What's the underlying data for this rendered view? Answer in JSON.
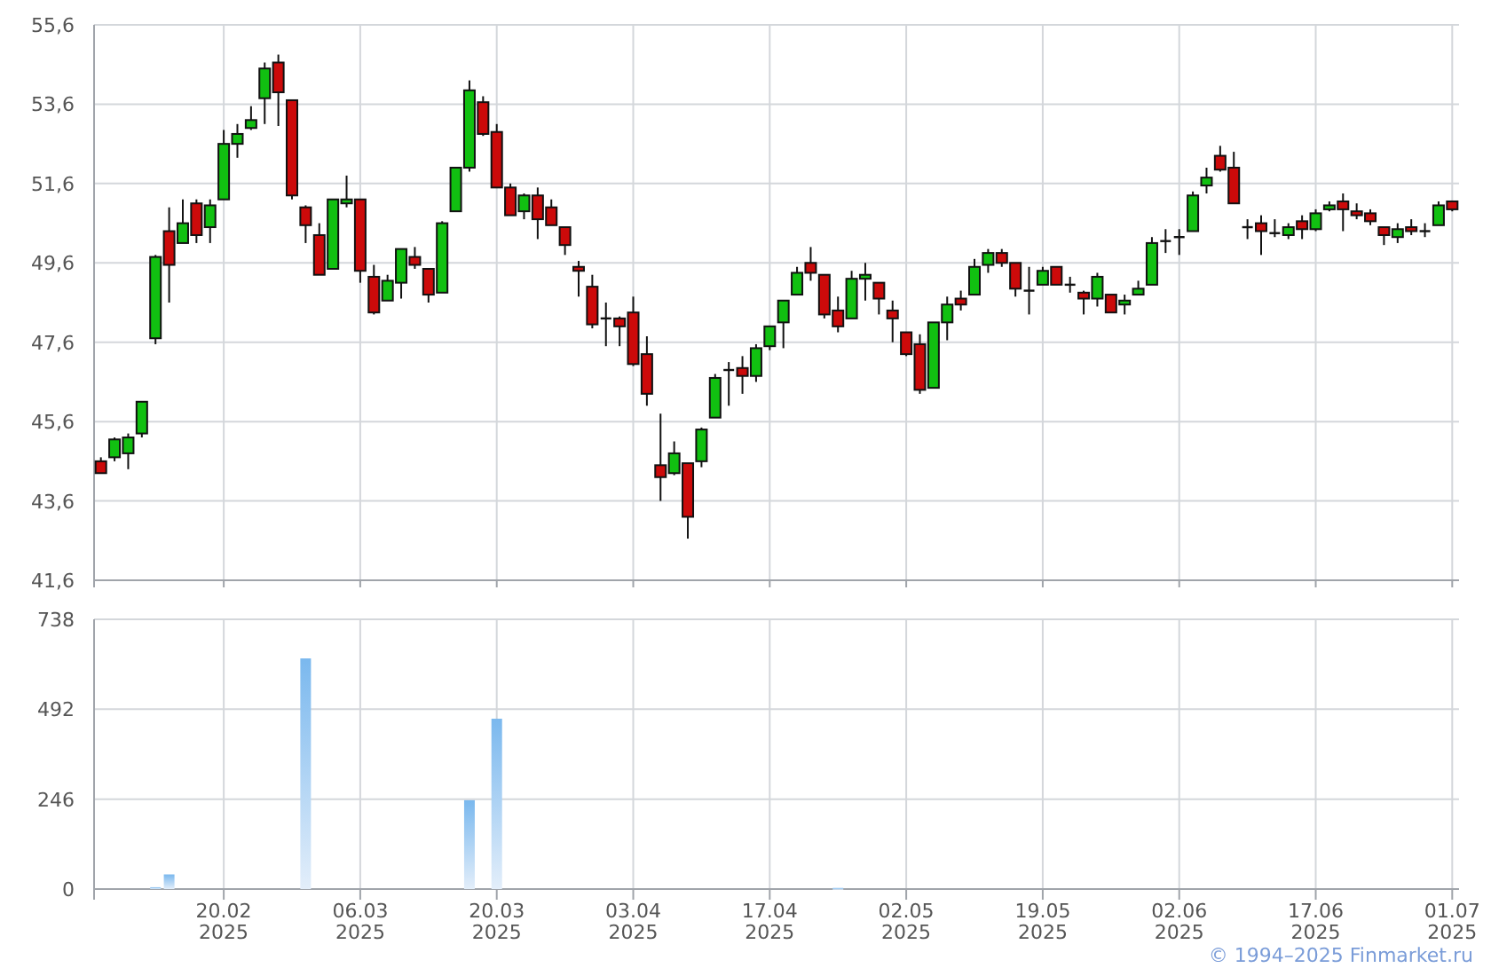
{
  "price_chart": {
    "chart_data": {
      "type": "candlestick",
      "grid": true,
      "categories": [
        null,
        null,
        null,
        null,
        null,
        null,
        null,
        null,
        null,
        null,
        null,
        null,
        null,
        null,
        null,
        null,
        null,
        null,
        null,
        null,
        null,
        null,
        null,
        null,
        null,
        null,
        null,
        null,
        null,
        null,
        null,
        null,
        null,
        null,
        null,
        null,
        null,
        null,
        null,
        null,
        null,
        null,
        null,
        null,
        null,
        null,
        null,
        null,
        null,
        null,
        null,
        null,
        null,
        null,
        null,
        null,
        null,
        null,
        null,
        null,
        null,
        null,
        null,
        null,
        null,
        null,
        null,
        null,
        null,
        null,
        null,
        null,
        null,
        null,
        null,
        null,
        null,
        null,
        null,
        null,
        null,
        null,
        null,
        null,
        null,
        null,
        null,
        null,
        null,
        null,
        null,
        null,
        null,
        null,
        null,
        null,
        null,
        null,
        null,
        null
      ],
      "ylim": [
        41.6,
        55.6
      ],
      "yticks": [
        {
          "value": 41.6,
          "label": "41,6"
        },
        {
          "value": 43.6,
          "label": "43,6"
        },
        {
          "value": 45.6,
          "label": "45,6"
        },
        {
          "value": 47.6,
          "label": "47,6"
        },
        {
          "value": 49.6,
          "label": "49,6"
        },
        {
          "value": 51.6,
          "label": "51,6"
        },
        {
          "value": 53.6,
          "label": "53,6"
        },
        {
          "value": 55.6,
          "label": "55,6"
        }
      ],
      "ohlc": [
        [
          44.6,
          44.7,
          44.3,
          44.3
        ],
        [
          44.7,
          45.2,
          44.6,
          45.15
        ],
        [
          44.8,
          45.3,
          44.4,
          45.2
        ],
        [
          45.3,
          46.1,
          45.2,
          46.1
        ],
        [
          47.7,
          49.8,
          47.55,
          49.75
        ],
        [
          50.4,
          51.0,
          48.6,
          49.55
        ],
        [
          50.1,
          51.2,
          50.1,
          50.6
        ],
        [
          51.1,
          51.2,
          50.1,
          50.3
        ],
        [
          50.5,
          51.2,
          50.1,
          51.05
        ],
        [
          51.2,
          52.95,
          51.2,
          52.6
        ],
        [
          52.6,
          53.1,
          52.25,
          52.85
        ],
        [
          53.0,
          53.55,
          52.95,
          53.2
        ],
        [
          53.75,
          54.65,
          53.1,
          54.5
        ],
        [
          54.65,
          54.85,
          53.05,
          53.9
        ],
        [
          53.7,
          53.7,
          51.2,
          51.3
        ],
        [
          51.0,
          51.05,
          50.1,
          50.55
        ],
        [
          50.3,
          50.6,
          49.3,
          49.3
        ],
        [
          49.45,
          51.2,
          49.45,
          51.2
        ],
        [
          51.1,
          51.8,
          51.0,
          51.2
        ],
        [
          51.2,
          51.2,
          49.1,
          49.4
        ],
        [
          49.25,
          49.55,
          48.3,
          48.35
        ],
        [
          48.65,
          49.3,
          48.65,
          49.15
        ],
        [
          49.1,
          49.95,
          48.7,
          49.95
        ],
        [
          49.75,
          50.0,
          49.45,
          49.55
        ],
        [
          49.45,
          49.45,
          48.6,
          48.8
        ],
        [
          48.85,
          50.65,
          48.85,
          50.6
        ],
        [
          50.9,
          52.0,
          50.9,
          52.0
        ],
        [
          52.0,
          54.2,
          51.9,
          53.95
        ],
        [
          53.65,
          53.8,
          52.8,
          52.85
        ],
        [
          52.9,
          53.1,
          51.5,
          51.5
        ],
        [
          51.5,
          51.6,
          50.8,
          50.8
        ],
        [
          50.9,
          51.35,
          50.7,
          51.3
        ],
        [
          51.3,
          51.5,
          50.2,
          50.7
        ],
        [
          51.0,
          51.2,
          50.55,
          50.55
        ],
        [
          50.5,
          50.5,
          49.8,
          50.05
        ],
        [
          49.5,
          49.65,
          48.75,
          49.4
        ],
        [
          49.0,
          49.3,
          47.95,
          48.05
        ],
        [
          48.2,
          48.6,
          47.5,
          48.2
        ],
        [
          48.2,
          48.25,
          47.5,
          48.0
        ],
        [
          48.35,
          48.75,
          47.0,
          47.05
        ],
        [
          47.3,
          47.75,
          46.0,
          46.3
        ],
        [
          44.5,
          45.8,
          43.6,
          44.2
        ],
        [
          44.3,
          45.1,
          44.25,
          44.8
        ],
        [
          44.55,
          44.55,
          42.65,
          43.2
        ],
        [
          44.6,
          45.45,
          44.45,
          45.4
        ],
        [
          45.7,
          46.8,
          45.7,
          46.7
        ],
        [
          46.9,
          47.1,
          46.0,
          46.9
        ],
        [
          46.95,
          47.25,
          46.3,
          46.75
        ],
        [
          46.75,
          47.55,
          46.6,
          47.45
        ],
        [
          47.5,
          48.0,
          47.4,
          48.0
        ],
        [
          48.1,
          48.65,
          47.45,
          48.65
        ],
        [
          48.8,
          49.5,
          48.8,
          49.35
        ],
        [
          49.6,
          50.0,
          49.15,
          49.35
        ],
        [
          49.3,
          49.3,
          48.2,
          48.3
        ],
        [
          48.4,
          48.75,
          47.85,
          48.0
        ],
        [
          48.2,
          49.4,
          48.2,
          49.2
        ],
        [
          49.2,
          49.6,
          48.65,
          49.3
        ],
        [
          49.1,
          49.1,
          48.3,
          48.7
        ],
        [
          48.4,
          48.65,
          47.6,
          48.2
        ],
        [
          47.85,
          47.85,
          47.25,
          47.3
        ],
        [
          47.55,
          47.8,
          46.3,
          46.4
        ],
        [
          46.45,
          48.1,
          46.45,
          48.1
        ],
        [
          48.1,
          48.75,
          47.65,
          48.55
        ],
        [
          48.7,
          48.9,
          48.4,
          48.55
        ],
        [
          48.8,
          49.7,
          48.8,
          49.5
        ],
        [
          49.55,
          49.95,
          49.35,
          49.85
        ],
        [
          49.85,
          49.95,
          49.5,
          49.6
        ],
        [
          49.6,
          49.6,
          48.75,
          48.95
        ],
        [
          48.9,
          49.5,
          48.3,
          48.9
        ],
        [
          49.05,
          49.5,
          49.05,
          49.4
        ],
        [
          49.5,
          49.5,
          49.05,
          49.05
        ],
        [
          49.05,
          49.25,
          48.85,
          49.05
        ],
        [
          48.85,
          48.9,
          48.3,
          48.7
        ],
        [
          48.7,
          49.35,
          48.5,
          49.25
        ],
        [
          48.8,
          48.8,
          48.35,
          48.35
        ],
        [
          48.55,
          48.8,
          48.3,
          48.65
        ],
        [
          48.8,
          49.15,
          48.8,
          48.95
        ],
        [
          49.05,
          50.25,
          49.05,
          50.1
        ],
        [
          50.15,
          50.45,
          49.85,
          50.15
        ],
        [
          50.25,
          50.45,
          49.8,
          50.25
        ],
        [
          50.4,
          51.4,
          50.4,
          51.3
        ],
        [
          51.55,
          52.0,
          51.35,
          51.75
        ],
        [
          52.3,
          52.55,
          51.9,
          51.95
        ],
        [
          52.0,
          52.4,
          51.1,
          51.1
        ],
        [
          50.5,
          50.7,
          50.2,
          50.5
        ],
        [
          50.6,
          50.8,
          49.8,
          50.4
        ],
        [
          50.35,
          50.7,
          50.25,
          50.35
        ],
        [
          50.3,
          50.6,
          50.2,
          50.5
        ],
        [
          50.65,
          50.8,
          50.2,
          50.45
        ],
        [
          50.45,
          50.95,
          50.4,
          50.85
        ],
        [
          50.95,
          51.15,
          50.9,
          51.05
        ],
        [
          51.15,
          51.35,
          50.4,
          50.95
        ],
        [
          50.9,
          51.1,
          50.7,
          50.8
        ],
        [
          50.85,
          50.95,
          50.55,
          50.65
        ],
        [
          50.5,
          50.5,
          50.05,
          50.3
        ],
        [
          50.25,
          50.6,
          50.1,
          50.45
        ],
        [
          50.5,
          50.7,
          50.3,
          50.4
        ],
        [
          50.4,
          50.6,
          50.25,
          50.4
        ],
        [
          50.55,
          51.15,
          50.55,
          51.05
        ],
        [
          51.15,
          51.15,
          50.9,
          50.95
        ]
      ]
    }
  },
  "volume_chart": {
    "chart_data": {
      "type": "bar",
      "grid": true,
      "categories": [
        null,
        null,
        null,
        null,
        null,
        null,
        null,
        null,
        null,
        "20.02 2025",
        null,
        null,
        null,
        null,
        null,
        null,
        null,
        null,
        null,
        "06.03 2025",
        null,
        null,
        null,
        null,
        null,
        null,
        null,
        null,
        null,
        "20.03 2025",
        null,
        null,
        null,
        null,
        null,
        null,
        null,
        null,
        null,
        "03.04 2025",
        null,
        null,
        null,
        null,
        null,
        null,
        null,
        null,
        null,
        "17.04 2025",
        null,
        null,
        null,
        null,
        null,
        null,
        null,
        null,
        null,
        "02.05 2025",
        null,
        null,
        null,
        null,
        null,
        null,
        null,
        null,
        null,
        "19.05 2025",
        null,
        null,
        null,
        null,
        null,
        null,
        null,
        null,
        null,
        "02.06 2025",
        null,
        null,
        null,
        null,
        null,
        null,
        null,
        null,
        null,
        "17.06 2025",
        null,
        null,
        null,
        null,
        null,
        null,
        null,
        null,
        null,
        "01.07 2025"
      ],
      "ylim": [
        0,
        738
      ],
      "yticks": [
        0,
        246,
        492,
        738
      ],
      "series": [
        {
          "color": "#7ab8ee",
          "values": [
            0,
            0,
            0,
            0,
            5,
            40,
            0,
            0,
            0,
            0,
            0,
            0,
            0,
            0,
            0,
            631,
            0,
            0,
            0,
            0,
            0,
            0,
            0,
            0,
            0,
            0,
            0,
            243,
            0,
            466,
            0,
            0,
            0,
            0,
            0,
            0,
            0,
            0,
            0,
            0,
            0,
            0,
            0,
            0,
            0,
            0,
            0,
            0,
            0,
            0,
            0,
            0,
            0,
            0,
            3,
            0,
            0,
            0,
            0,
            0,
            0,
            0,
            0,
            0,
            0,
            0,
            0,
            0,
            0,
            0,
            0,
            0,
            0,
            0,
            0,
            0,
            0,
            0,
            0,
            0,
            0,
            0,
            0,
            0,
            0,
            0,
            0,
            0,
            0,
            0,
            0,
            0,
            0,
            0,
            0,
            0,
            0,
            0,
            0,
            0
          ]
        }
      ]
    }
  },
  "footer": {
    "copyright": "© 1994–2025 Finmarket.ru"
  }
}
